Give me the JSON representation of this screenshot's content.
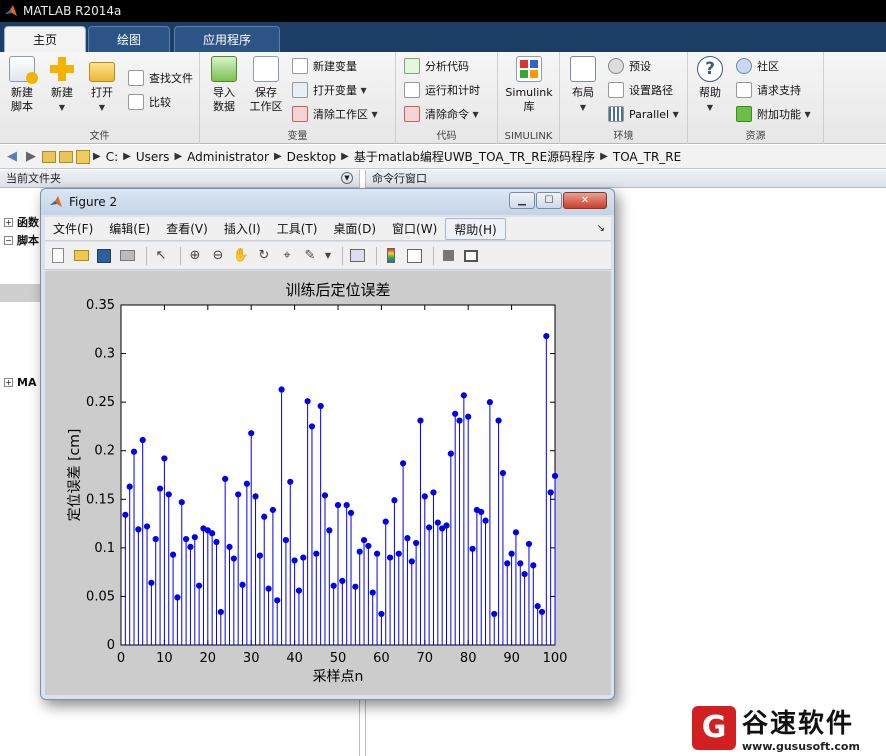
{
  "app": {
    "title": "MATLAB R2014a"
  },
  "tabs": [
    {
      "label": "主页"
    },
    {
      "label": "绘图"
    },
    {
      "label": "应用程序"
    }
  ],
  "ribbon": {
    "file": {
      "label": "文件",
      "new_script": "新建\n脚本",
      "new": "新建",
      "open": "打开",
      "find_files": "查找文件",
      "compare": "比较"
    },
    "variable": {
      "label": "变量",
      "import": "导入\n数据",
      "save_workspace": "保存\n工作区",
      "new_variable": "新建变量",
      "open_variable": "打开变量",
      "clear_workspace": "清除工作区"
    },
    "code": {
      "label": "代码",
      "analyze": "分析代码",
      "run_time": "运行和计时",
      "clear_commands": "清除命令"
    },
    "simulink": {
      "label": "SIMULINK",
      "library": "Simulink\n库"
    },
    "environment": {
      "label": "环境",
      "layout": "布局",
      "preferences": "预设",
      "set_path": "设置路径",
      "parallel": "Parallel"
    },
    "resources": {
      "label": "资源",
      "help": "帮助",
      "community": "社区",
      "request_support": "请求支持",
      "addons": "附加功能"
    }
  },
  "address": {
    "crumbs": [
      "C:",
      "Users",
      "Administrator",
      "Desktop",
      "基于matlab编程UWB_TOA_TR_RE源码程序",
      "TOA_TR_RE"
    ]
  },
  "panels": {
    "current_folder": "当前文件夹",
    "command_window": "命令行窗口",
    "tree": [
      "函数",
      "脚本",
      "MA"
    ]
  },
  "figure": {
    "title": "Figure 2",
    "menu": [
      "文件(F)",
      "编辑(E)",
      "查看(V)",
      "插入(I)",
      "工具(T)",
      "桌面(D)",
      "窗口(W)",
      "帮助(H)"
    ]
  },
  "chart_data": {
    "type": "stem",
    "title": "训练后定位误差",
    "xlabel": "采样点n",
    "ylabel": "定位误差 [cm]",
    "xlim": [
      0,
      100
    ],
    "ylim": [
      0,
      0.35
    ],
    "xticks": [
      0,
      10,
      20,
      30,
      40,
      50,
      60,
      70,
      80,
      90,
      100
    ],
    "yticks": [
      0,
      0.05,
      0.1,
      0.15,
      0.2,
      0.25,
      0.3,
      0.35
    ],
    "color": "#0000ee",
    "x": [
      1,
      2,
      3,
      4,
      5,
      6,
      7,
      8,
      9,
      10,
      11,
      12,
      13,
      14,
      15,
      16,
      17,
      18,
      19,
      20,
      21,
      22,
      23,
      24,
      25,
      26,
      27,
      28,
      29,
      30,
      31,
      32,
      33,
      34,
      35,
      36,
      37,
      38,
      39,
      40,
      41,
      42,
      43,
      44,
      45,
      46,
      47,
      48,
      49,
      50,
      51,
      52,
      53,
      54,
      55,
      56,
      57,
      58,
      59,
      60,
      61,
      62,
      63,
      64,
      65,
      66,
      67,
      68,
      69,
      70,
      71,
      72,
      73,
      74,
      75,
      76,
      77,
      78,
      79,
      80,
      81,
      82,
      83,
      84,
      85,
      86,
      87,
      88,
      89,
      90,
      91,
      92,
      93,
      94,
      95,
      96,
      97,
      98,
      99,
      100
    ],
    "values": [
      0.134,
      0.163,
      0.199,
      0.119,
      0.211,
      0.122,
      0.064,
      0.109,
      0.161,
      0.192,
      0.155,
      0.093,
      0.049,
      0.147,
      0.109,
      0.101,
      0.111,
      0.061,
      0.12,
      0.118,
      0.115,
      0.106,
      0.034,
      0.171,
      0.101,
      0.089,
      0.155,
      0.062,
      0.166,
      0.218,
      0.153,
      0.092,
      0.132,
      0.058,
      0.139,
      0.046,
      0.263,
      0.108,
      0.168,
      0.087,
      0.056,
      0.09,
      0.251,
      0.225,
      0.094,
      0.246,
      0.154,
      0.118,
      0.061,
      0.144,
      0.066,
      0.144,
      0.136,
      0.06,
      0.096,
      0.108,
      0.102,
      0.054,
      0.094,
      0.032,
      0.127,
      0.09,
      0.149,
      0.094,
      0.187,
      0.11,
      0.086,
      0.105,
      0.231,
      0.153,
      0.121,
      0.157,
      0.126,
      0.12,
      0.123,
      0.197,
      0.238,
      0.231,
      0.257,
      0.235,
      0.099,
      0.139,
      0.137,
      0.128,
      0.25,
      0.032,
      0.231,
      0.177,
      0.084,
      0.094,
      0.116,
      0.084,
      0.073,
      0.104,
      0.082,
      0.04,
      0.034,
      0.318,
      0.157,
      0.174
    ]
  },
  "watermark": {
    "name": "谷速软件",
    "url": "www.gususoft.com",
    "mark": "G"
  }
}
